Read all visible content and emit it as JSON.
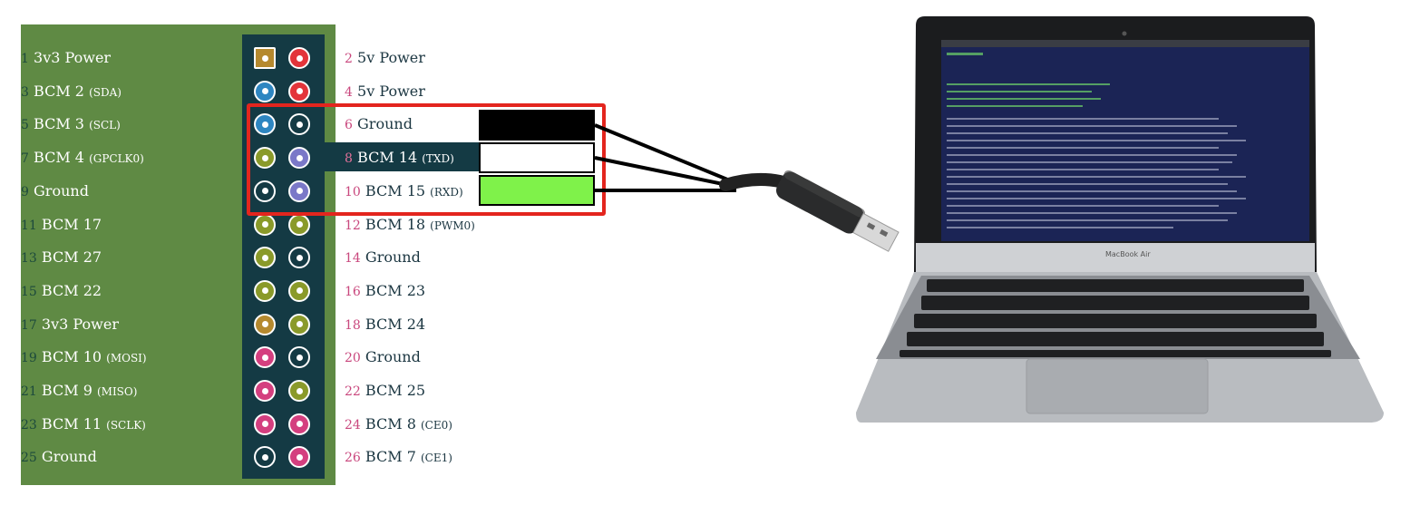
{
  "colors": {
    "board": "#5f8a44",
    "header": "#143a44",
    "power3v3": "#b5892e",
    "power5v": "#e3343a",
    "i2c": "#2e86c1",
    "ground": "#143a44",
    "gpio": "#8a9a2a",
    "uart": "#7a78c8",
    "spi": "#d43f7f",
    "highlight": "#e3251e",
    "wire_black": "#000000",
    "wire_white": "#ffffff",
    "wire_green": "#7ff24a"
  },
  "rows": [
    {
      "left": {
        "num": "1",
        "name": "3v3 Power",
        "sub": "",
        "type": "power3v3"
      },
      "right": {
        "num": "2",
        "name": "5v Power",
        "sub": "",
        "type": "power5v"
      }
    },
    {
      "left": {
        "num": "3",
        "name": "BCM 2",
        "sub": "(SDA)",
        "type": "i2c"
      },
      "right": {
        "num": "4",
        "name": "5v Power",
        "sub": "",
        "type": "power5v"
      }
    },
    {
      "left": {
        "num": "5",
        "name": "BCM 3",
        "sub": "(SCL)",
        "type": "i2c"
      },
      "right": {
        "num": "6",
        "name": "Ground",
        "sub": "",
        "type": "ground"
      }
    },
    {
      "left": {
        "num": "7",
        "name": "BCM 4",
        "sub": "(GPCLK0)",
        "type": "gpio"
      },
      "right": {
        "num": "8",
        "name": "BCM 14",
        "sub": "(TXD)",
        "type": "uart"
      }
    },
    {
      "left": {
        "num": "9",
        "name": "Ground",
        "sub": "",
        "type": "ground"
      },
      "right": {
        "num": "10",
        "name": "BCM 15",
        "sub": "(RXD)",
        "type": "uart"
      }
    },
    {
      "left": {
        "num": "11",
        "name": "BCM 17",
        "sub": "",
        "type": "gpio"
      },
      "right": {
        "num": "12",
        "name": "BCM 18",
        "sub": "(PWM0)",
        "type": "gpio"
      }
    },
    {
      "left": {
        "num": "13",
        "name": "BCM 27",
        "sub": "",
        "type": "gpio"
      },
      "right": {
        "num": "14",
        "name": "Ground",
        "sub": "",
        "type": "ground"
      }
    },
    {
      "left": {
        "num": "15",
        "name": "BCM 22",
        "sub": "",
        "type": "gpio"
      },
      "right": {
        "num": "16",
        "name": "BCM 23",
        "sub": "",
        "type": "gpio"
      }
    },
    {
      "left": {
        "num": "17",
        "name": "3v3 Power",
        "sub": "",
        "type": "power3v3"
      },
      "right": {
        "num": "18",
        "name": "BCM 24",
        "sub": "",
        "type": "gpio"
      }
    },
    {
      "left": {
        "num": "19",
        "name": "BCM 10",
        "sub": "(MOSI)",
        "type": "spi"
      },
      "right": {
        "num": "20",
        "name": "Ground",
        "sub": "",
        "type": "ground"
      }
    },
    {
      "left": {
        "num": "21",
        "name": "BCM 9",
        "sub": "(MISO)",
        "type": "spi"
      },
      "right": {
        "num": "22",
        "name": "BCM 25",
        "sub": "",
        "type": "gpio"
      }
    },
    {
      "left": {
        "num": "23",
        "name": "BCM 11",
        "sub": "(SCLK)",
        "type": "spi"
      },
      "right": {
        "num": "24",
        "name": "BCM 8",
        "sub": "(CE0)",
        "type": "spi"
      }
    },
    {
      "left": {
        "num": "25",
        "name": "Ground",
        "sub": "",
        "type": "ground"
      },
      "right": {
        "num": "26",
        "name": "BCM 7",
        "sub": "(CE1)",
        "type": "spi"
      }
    }
  ],
  "laptop": {
    "label": "MacBook Air"
  }
}
